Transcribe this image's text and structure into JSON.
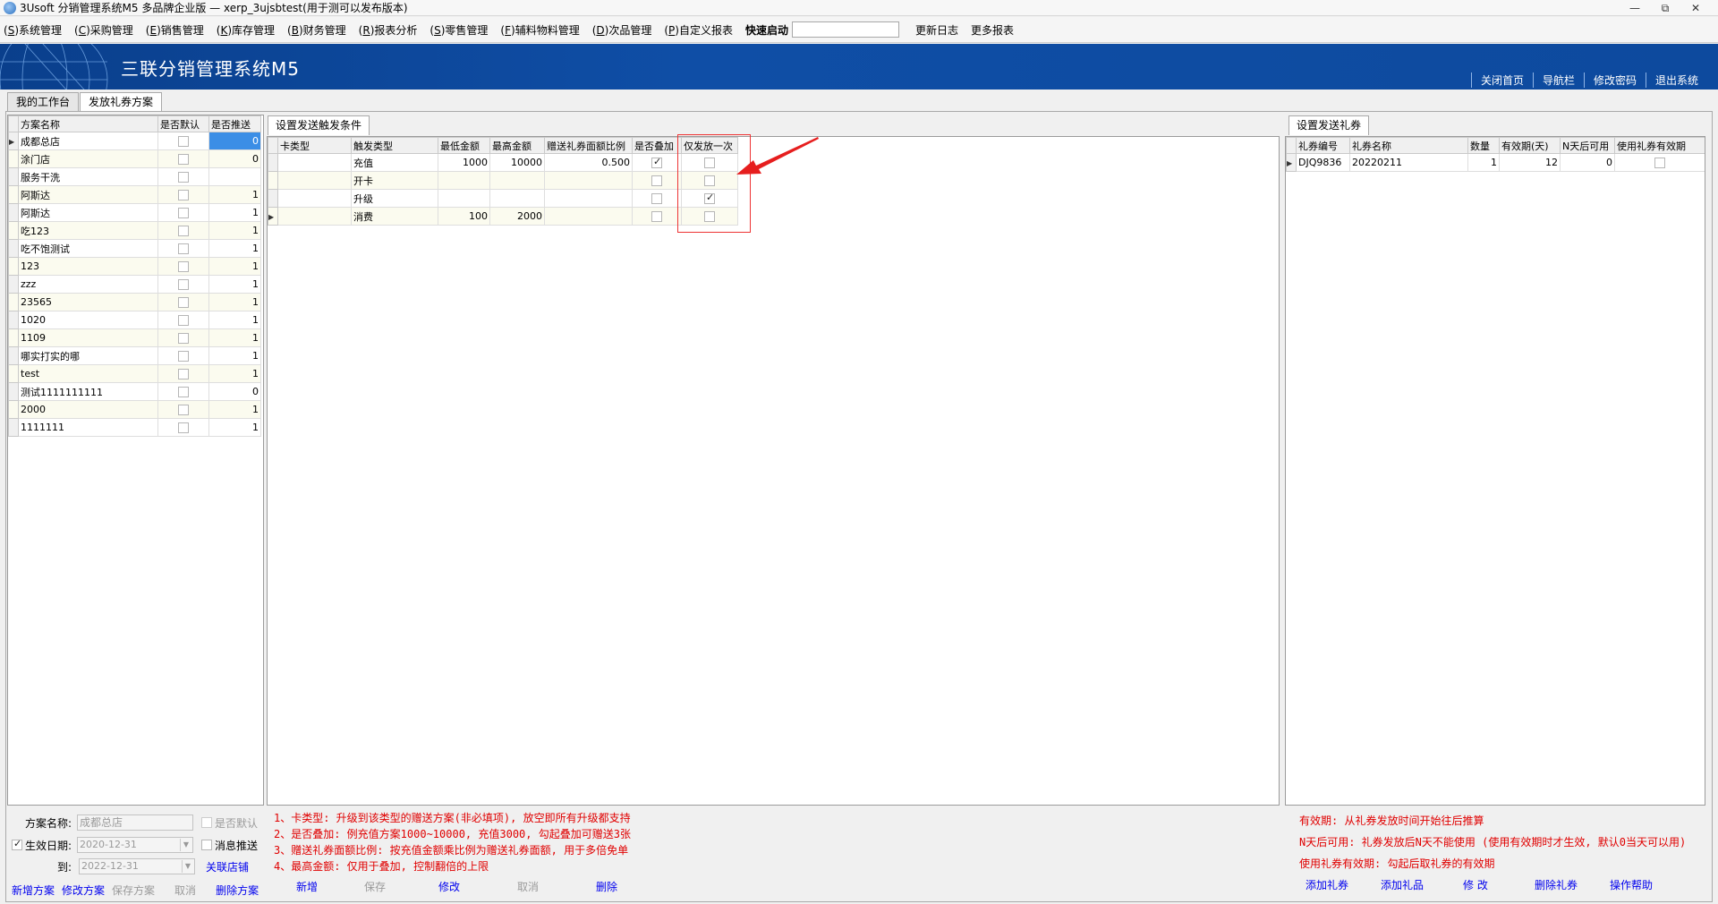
{
  "window": {
    "title": "3Usoft 分销管理系统M5 多品牌企业版 — xerp_3ujsbtest(用于测可以发布版本)",
    "controls": [
      "—",
      "⧉",
      "✕"
    ]
  },
  "menu": {
    "items": [
      {
        "key": "S",
        "label": "系统管理"
      },
      {
        "key": "C",
        "label": "采购管理"
      },
      {
        "key": "E",
        "label": "销售管理"
      },
      {
        "key": "K",
        "label": "库存管理"
      },
      {
        "key": "B",
        "label": "财务管理"
      },
      {
        "key": "R",
        "label": "报表分析"
      },
      {
        "key": "S",
        "label": "零售管理"
      },
      {
        "key": "F",
        "label": "辅料物料管理"
      },
      {
        "key": "D",
        "label": "次品管理"
      },
      {
        "key": "P",
        "label": "自定义报表"
      }
    ],
    "quick_start_label": "快速启动",
    "quick_start_value": "",
    "changelog": "更新日志",
    "more_reports": "更多报表"
  },
  "banner": {
    "brand": "三联分销管理系统M5",
    "links": [
      "关闭首页",
      "导航栏",
      "修改密码",
      "退出系统"
    ]
  },
  "doc_tabs": [
    "我的工作台",
    "发放礼券方案"
  ],
  "left_grid": {
    "columns": [
      "方案名称",
      "是否默认",
      "是否推送"
    ],
    "rows": [
      {
        "name": "成都总店",
        "default": false,
        "push": "0",
        "selected": true
      },
      {
        "name": "涂门店",
        "default": false,
        "push": "0"
      },
      {
        "name": "服务干洗",
        "default": false,
        "push": ""
      },
      {
        "name": "阿斯达",
        "default": false,
        "push": "1"
      },
      {
        "name": "阿斯达",
        "default": false,
        "push": "1"
      },
      {
        "name": "吃123",
        "default": false,
        "push": "1"
      },
      {
        "name": "吃不饱测试",
        "default": false,
        "push": "1"
      },
      {
        "name": "123",
        "default": false,
        "push": "1"
      },
      {
        "name": "zzz",
        "default": false,
        "push": "1"
      },
      {
        "name": "23565",
        "default": false,
        "push": "1"
      },
      {
        "name": "1020",
        "default": false,
        "push": "1"
      },
      {
        "name": "1109",
        "default": false,
        "push": "1"
      },
      {
        "name": "哪实打实的哪",
        "default": false,
        "push": "1"
      },
      {
        "name": "test",
        "default": false,
        "push": "1"
      },
      {
        "name": "测试1111111111",
        "default": false,
        "push": "0"
      },
      {
        "name": "2000",
        "default": false,
        "push": "1"
      },
      {
        "name": "1111111",
        "default": false,
        "push": "1"
      }
    ]
  },
  "left_form": {
    "name_label": "方案名称:",
    "name_value": "成都总店",
    "default_label": "是否默认",
    "effective_label": "生效日期:",
    "effective_checked": true,
    "effective_from": "2020-12-31",
    "push_label": "消息推送",
    "to_label": "到:",
    "effective_to": "2022-12-31",
    "link_stores": "关联店铺",
    "buttons": [
      "新增方案",
      "修改方案",
      "保存方案",
      "取消",
      "删除方案"
    ]
  },
  "mid_panel": {
    "tab": "设置发送触发条件",
    "columns": [
      "卡类型",
      "触发类型",
      "最低金额",
      "最高金额",
      "赠送礼券面额比例",
      "是否叠加",
      "仅发放一次"
    ],
    "rows": [
      {
        "card": "",
        "trigger": "充值",
        "min": "1000",
        "max": "10000",
        "ratio": "0.500",
        "stack": true,
        "once": false
      },
      {
        "card": "",
        "trigger": "开卡",
        "min": "",
        "max": "",
        "ratio": "",
        "stack": false,
        "once": false
      },
      {
        "card": "",
        "trigger": "升级",
        "min": "",
        "max": "",
        "ratio": "",
        "stack": false,
        "once": true
      },
      {
        "card": "",
        "trigger": "消费",
        "min": "100",
        "max": "2000",
        "ratio": "",
        "stack": false,
        "once": false,
        "current": true
      }
    ],
    "notes": [
      "1、卡类型: 升级到该类型的赠送方案(非必填项), 放空即所有升级都支持",
      "2、是否叠加: 例充值方案1000~10000, 充值3000, 勾起叠加可赠送3张",
      "3、赠送礼券面额比例: 按充值金额乘比例为赠送礼券面额, 用于多倍免单",
      "4、最高金额: 仅用于叠加, 控制翻倍的上限"
    ],
    "buttons": [
      "新增",
      "保存",
      "修改",
      "取消",
      "删除"
    ]
  },
  "right_panel": {
    "tab": "设置发送礼券",
    "columns": [
      "礼券编号",
      "礼券名称",
      "数量",
      "有效期(天)",
      "N天后可用",
      "使用礼券有效期"
    ],
    "rows": [
      {
        "code": "DJQ9836",
        "name": "20220211",
        "qty": "1",
        "days": "12",
        "after": "0",
        "use_valid": false
      }
    ],
    "notes": [
      "有效期: 从礼券发放时间开始往后推算",
      "N天后可用: 礼券发放后N天不能使用 (使用有效期时才生效, 默认0当天可以用)",
      "使用礼券有效期: 勾起后取礼券的有效期"
    ],
    "buttons": [
      "添加礼券",
      "添加礼品",
      "修 改",
      "删除礼券",
      "操作帮助"
    ]
  },
  "colors": {
    "banner": "#0f4ea6",
    "selection": "#3b8ee6",
    "note_red": "#e00000",
    "link_blue": "#0000ee"
  }
}
